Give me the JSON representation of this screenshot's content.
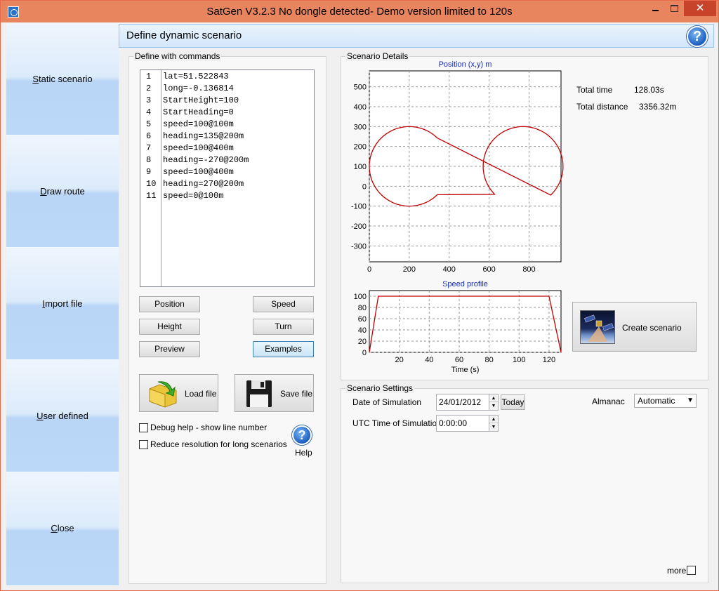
{
  "window": {
    "title": "SatGen V3.2.3 No dongle detected- Demo version limited to 120s",
    "close_glyph": "✕"
  },
  "sidebar": {
    "items": [
      {
        "label_first": "S",
        "label_rest": "tatic scenario"
      },
      {
        "label_first": "D",
        "label_rest": "raw route"
      },
      {
        "label_first": "I",
        "label_rest": "mport file"
      },
      {
        "label_first": "U",
        "label_rest": "ser defined"
      },
      {
        "label_first": "C",
        "label_rest": "lose"
      }
    ]
  },
  "header": {
    "title": "Define dynamic scenario",
    "help_glyph": "?"
  },
  "commands": {
    "group_label": "Define with commands",
    "lines": [
      {
        "n": "1",
        "text": "lat=51.522843"
      },
      {
        "n": "2",
        "text": "long=-0.136814"
      },
      {
        "n": "3",
        "text": "StartHeight=100"
      },
      {
        "n": "4",
        "text": "StartHeading=0"
      },
      {
        "n": "5",
        "text": "speed=100@100m"
      },
      {
        "n": "6",
        "text": "heading=135@200m"
      },
      {
        "n": "7",
        "text": "speed=100@400m"
      },
      {
        "n": "8",
        "text": "heading=-270@200m"
      },
      {
        "n": "9",
        "text": "speed=100@400m"
      },
      {
        "n": "10",
        "text": "heading=270@200m"
      },
      {
        "n": "11",
        "text": "speed=0@100m"
      }
    ],
    "buttons": {
      "position": "Position",
      "speed": "Speed",
      "height": "Height",
      "turn": "Turn",
      "preview": "Preview",
      "examples": "Examples"
    },
    "load_file": "Load file",
    "save_file": "Save file",
    "debug_help": "Debug help - show line number",
    "reduce_resolution": "Reduce resolution for long scenarios",
    "help_label": "Help"
  },
  "details": {
    "group_label": "Scenario Details",
    "total_time_label": "Total time",
    "total_time_value": "128.03s",
    "total_distance_label": "Total distance",
    "total_distance_value": "3356.32m",
    "create_scenario": "Create scenario"
  },
  "chart_data": [
    {
      "type": "line",
      "title": "Position (x,y) m",
      "xlabel": "",
      "ylabel": "",
      "xlim": [
        0,
        960
      ],
      "ylim": [
        -380,
        580
      ],
      "xticks": [
        0,
        200,
        400,
        600,
        800
      ],
      "yticks": [
        -300,
        -200,
        -100,
        0,
        100,
        200,
        300,
        400,
        500
      ],
      "grid": true,
      "series": [
        {
          "description": "figure-eight path: circle centered (200,100) r=200, straight diagonal to circle centered (770,100) r=200, back through (485,100)",
          "color": "#c00000"
        }
      ]
    },
    {
      "type": "line",
      "title": "Speed profile",
      "xlabel": "Time (s)",
      "ylabel": "",
      "xlim": [
        0,
        128
      ],
      "ylim": [
        0,
        110
      ],
      "xticks": [
        20,
        40,
        60,
        80,
        100,
        120
      ],
      "yticks": [
        0,
        20,
        40,
        60,
        80,
        100
      ],
      "grid": true,
      "x": [
        0,
        6,
        120,
        128
      ],
      "values": [
        0,
        100,
        100,
        0
      ],
      "color": "#c00000"
    }
  ],
  "settings": {
    "group_label": "Scenario Settings",
    "date_label": "Date of Simulation",
    "date_value": "24/01/2012",
    "today_button": "Today",
    "utc_label": "UTC Time of Simulation",
    "utc_value": "0:00:00",
    "almanac_label": "Almanac",
    "almanac_value": "Automatic",
    "more_label": "more"
  }
}
